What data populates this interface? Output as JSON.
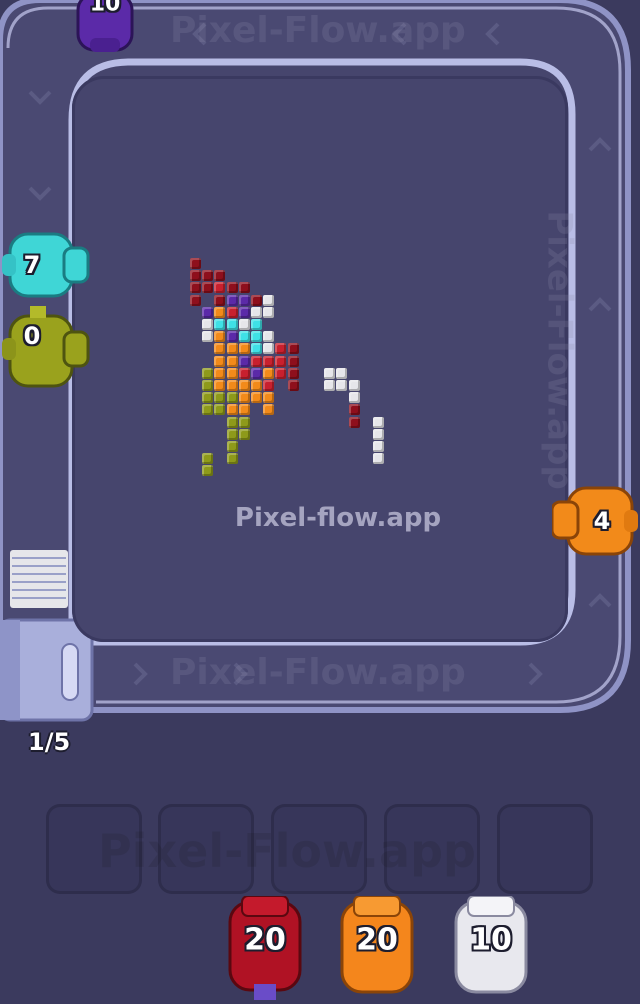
{
  "watermark_center": "Pixel-flow.app",
  "watermark_track_top": "Pixel-Flow.app",
  "watermark_track_right": "Pixel-Flow.app",
  "watermark_track_bottom": "Pixel-Flow.app",
  "watermark_tray": "Pixel-Flow.app",
  "queue_counter": "1/5",
  "track_shooters": [
    {
      "name": "shooter-purple",
      "count": "10",
      "color": "#5b2aa8"
    },
    {
      "name": "shooter-cyan",
      "count": "7",
      "color": "#3fd6d6"
    },
    {
      "name": "shooter-olive",
      "count": "0",
      "color": "#9aa21d"
    },
    {
      "name": "shooter-orange",
      "count": "4",
      "color": "#f28a1a"
    }
  ],
  "tray_slots": [
    "",
    "",
    "",
    "",
    ""
  ],
  "waiting_shooters": [
    {
      "name": "waiting-red",
      "count": "20",
      "color": "#b01224"
    },
    {
      "name": "waiting-orange",
      "count": "20",
      "color": "#f4861c"
    },
    {
      "name": "waiting-white",
      "count": "10",
      "color": "#e8e8ee"
    }
  ],
  "colors": {
    "darkred": "#8e0f1c",
    "red": "#c8202e",
    "purple": "#5b2aa8",
    "cyan": "#3fe0e6",
    "orange": "#f28a1a",
    "olive": "#8e9a1a",
    "white": "#e6e6ea"
  }
}
